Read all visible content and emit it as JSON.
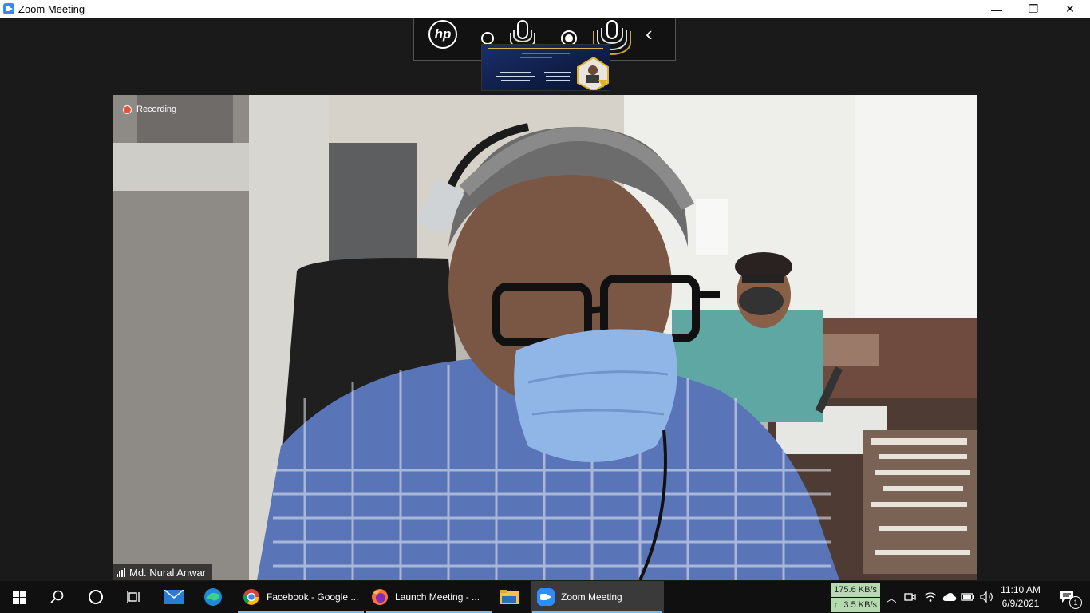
{
  "window": {
    "title": "Zoom Meeting",
    "minimize": "—",
    "restore": "❐",
    "close": "✕"
  },
  "hp_toolbar": {
    "logo": "hp",
    "collapse": "‹"
  },
  "meeting": {
    "recording_label": "Recording",
    "participant_name": "Md. Nural Anwar"
  },
  "taskbar": {
    "apps": [
      {
        "label": "Facebook - Google ...",
        "icon": "chrome-icon"
      },
      {
        "label": "Launch Meeting - ...",
        "icon": "firefox-icon"
      },
      {
        "label": "Zoom Meeting",
        "icon": "zoom-icon"
      }
    ],
    "net_down": "175.6 KB/s",
    "net_up": "3.5 KB/s",
    "time": "11:10 AM",
    "date": "6/9/2021",
    "notification_count": "1"
  }
}
